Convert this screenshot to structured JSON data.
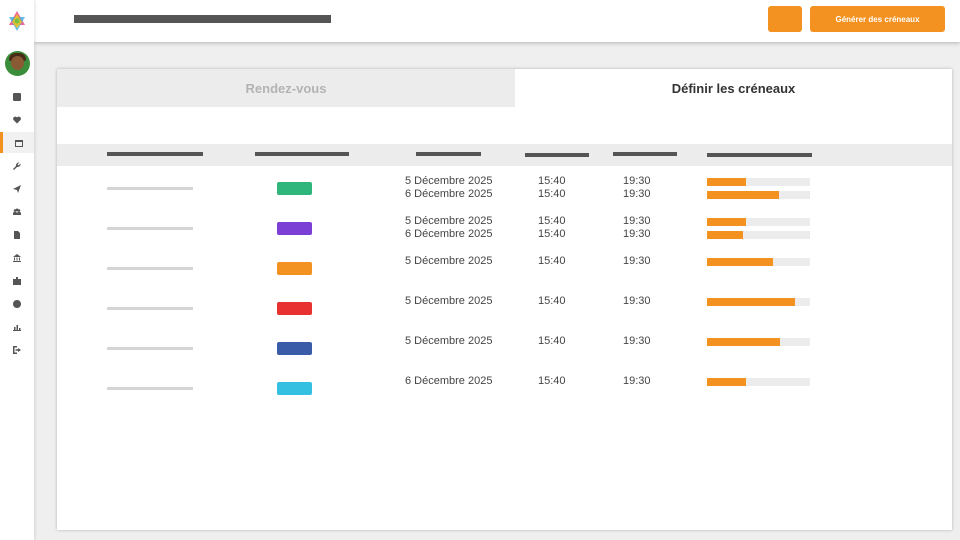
{
  "header": {
    "generate_label": "Générer des créneaux"
  },
  "tabs": [
    {
      "label": "Rendez-vous",
      "active": false
    },
    {
      "label": "Définir les créneaux",
      "active": true
    }
  ],
  "colors": {
    "accent": "#f39221",
    "swatches": [
      "#2eb67d",
      "#7b3fd6",
      "#f39221",
      "#e83232",
      "#3a5ca8",
      "#35bfe0"
    ]
  },
  "sidebar": {
    "items": [
      {
        "icon": "grid-icon"
      },
      {
        "icon": "heart-icon"
      },
      {
        "icon": "calendar-icon",
        "active": true
      },
      {
        "icon": "wrench-icon"
      },
      {
        "icon": "send-icon"
      },
      {
        "icon": "users-icon"
      },
      {
        "icon": "document-icon"
      },
      {
        "icon": "bank-icon"
      },
      {
        "icon": "briefcase-icon"
      },
      {
        "icon": "clock-icon"
      },
      {
        "icon": "chart-icon"
      },
      {
        "icon": "logout-icon"
      }
    ]
  },
  "rows": [
    {
      "color": "#2eb67d",
      "slots": [
        {
          "date": "5 Décembre 2025",
          "start": "15:40",
          "end": "19:30",
          "progress": 0.38
        },
        {
          "date": "6 Décembre 2025",
          "start": "15:40",
          "end": "19:30",
          "progress": 0.7
        }
      ]
    },
    {
      "color": "#7b3fd6",
      "slots": [
        {
          "date": "5 Décembre 2025",
          "start": "15:40",
          "end": "19:30",
          "progress": 0.38
        },
        {
          "date": "6 Décembre 2025",
          "start": "15:40",
          "end": "19:30",
          "progress": 0.35
        }
      ]
    },
    {
      "color": "#f39221",
      "slots": [
        {
          "date": "5 Décembre 2025",
          "start": "15:40",
          "end": "19:30",
          "progress": 0.64
        }
      ]
    },
    {
      "color": "#e83232",
      "slots": [
        {
          "date": "5 Décembre 2025",
          "start": "15:40",
          "end": "19:30",
          "progress": 0.85
        }
      ]
    },
    {
      "color": "#3a5ca8",
      "slots": [
        {
          "date": "5 Décembre 2025",
          "start": "15:40",
          "end": "19:30",
          "progress": 0.71
        }
      ]
    },
    {
      "color": "#35bfe0",
      "slots": [
        {
          "date": "6 Décembre 2025",
          "start": "15:40",
          "end": "19:30",
          "progress": 0.38
        }
      ]
    }
  ]
}
